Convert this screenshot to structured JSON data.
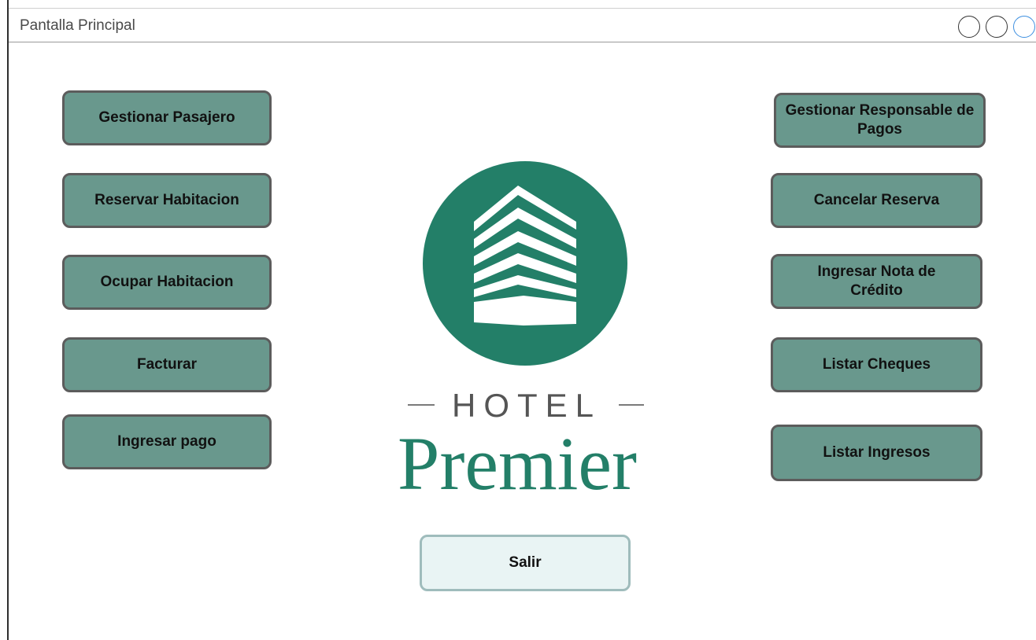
{
  "window": {
    "title": "Pantalla Principal"
  },
  "left_buttons": [
    "Gestionar Pasajero",
    "Reservar Habitacion",
    "Ocupar Habitacion",
    "Facturar",
    "Ingresar pago"
  ],
  "right_buttons": [
    "Gestionar Responsable de Pagos",
    "Cancelar Reserva",
    "Ingresar Nota de Crédito",
    "Listar Cheques",
    "Listar Ingresos"
  ],
  "exit_button": "Salir",
  "logo": {
    "line1": "HOTEL",
    "line2": "Premier"
  },
  "colors": {
    "button_fill": "#69988d",
    "button_border": "#5c5c5c",
    "logo_green": "#237f68",
    "exit_fill": "#e9f4f4"
  }
}
